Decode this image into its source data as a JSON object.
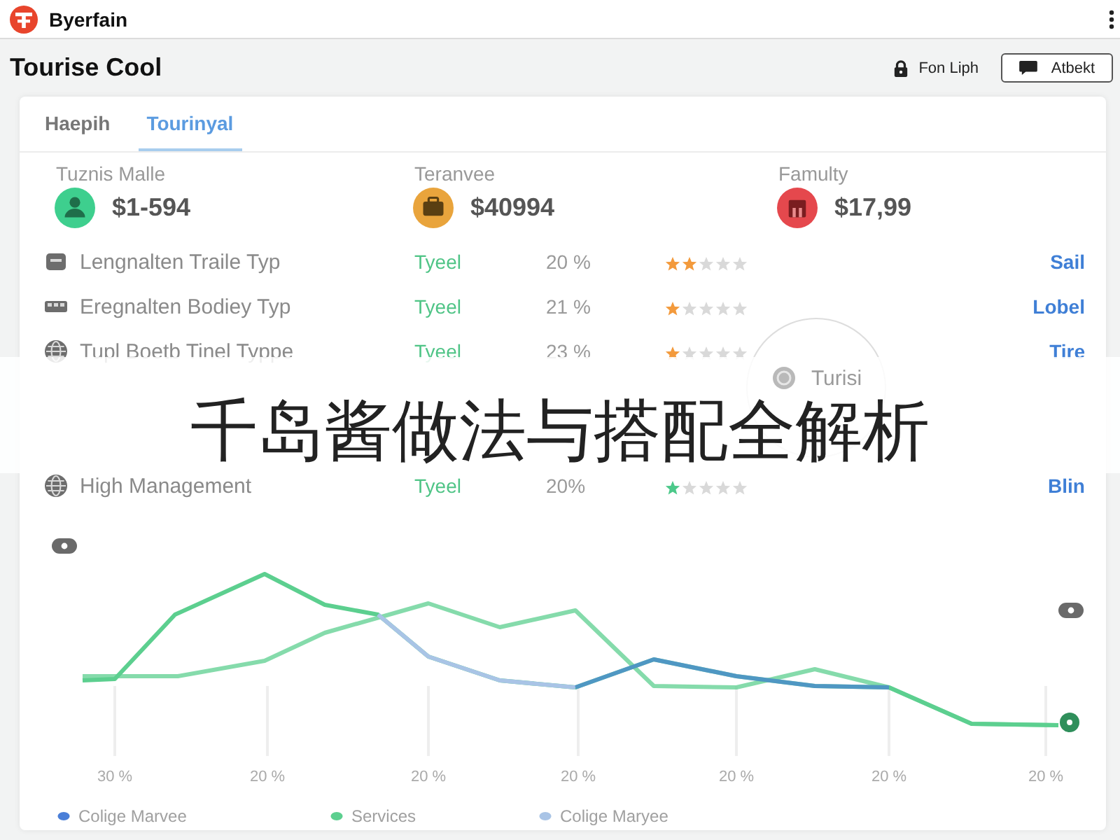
{
  "app_bar": {
    "brand": "Byerfain"
  },
  "header": {
    "title": "Tourise Cool",
    "lock_label": "Fon Liph",
    "button": "Atbekt"
  },
  "tabs": [
    {
      "label": "Haepih",
      "selected": false
    },
    {
      "label": "Tourinyal",
      "selected": true
    }
  ],
  "stats": [
    {
      "label": "Tuznis Malle",
      "value": "$1-594",
      "color": "#3ecf8e"
    },
    {
      "label": "Teranvee",
      "value": "$40994",
      "color": "#e9a43c"
    },
    {
      "label": "Famulty",
      "value": "$17,99",
      "color": "#e5484d"
    }
  ],
  "rows": [
    {
      "name": "Lengnalten Traile Typ",
      "status": "Tyeel",
      "percent": "20 %",
      "stars": 2,
      "color": "#f39a3c",
      "link": "Sail"
    },
    {
      "name": "Eregnalten Bodiey Typ",
      "status": "Tyeel",
      "percent": "21 %",
      "stars": 1,
      "color": "#f39a3c",
      "link": "Lobel"
    },
    {
      "name": "Tupl Boetb Tinel Typpe",
      "status": "Tyeel",
      "percent": "23 %",
      "stars": 1,
      "color": "#f39a3c",
      "link": "Tire"
    },
    {
      "name": "High Management",
      "status": "Tyeel",
      "percent": "20%",
      "stars": 1,
      "color": "#4cc98a",
      "link": "Blin"
    }
  ],
  "bubble": {
    "label": "Turisi"
  },
  "chart": {
    "x_labels": [
      "30 %",
      "20 %",
      "20 %",
      "20 %",
      "20 %",
      "20 %",
      "20 %"
    ],
    "legend": [
      {
        "name": "Colige Marvee",
        "color": "#4a7fd8"
      },
      {
        "name": "Services",
        "color": "#5ccf8f"
      },
      {
        "name": "Colige Maryee",
        "color": "#a9c4e6"
      }
    ]
  },
  "banner": {
    "title": "千岛酱做法与搭配全解析"
  }
}
